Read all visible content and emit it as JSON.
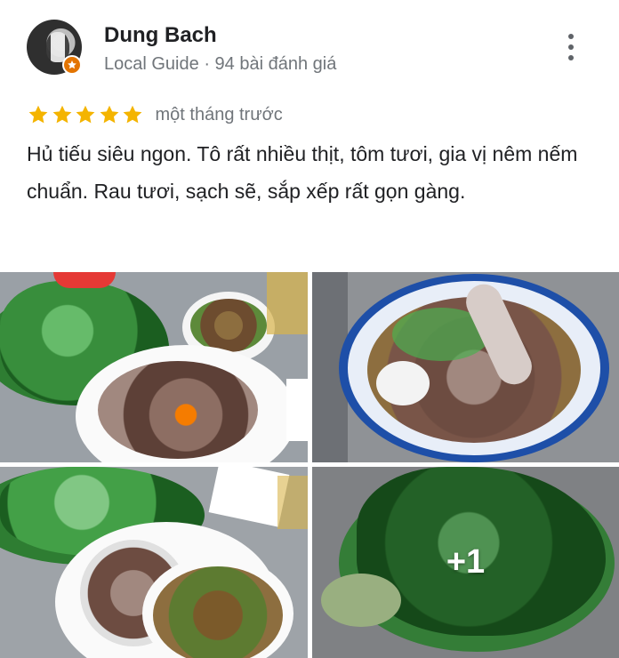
{
  "reviewer": {
    "name": "Dung Bach",
    "badge": "Local Guide",
    "separator": "·",
    "review_count": "94 bài đánh giá"
  },
  "review": {
    "stars": 5,
    "max_stars": 5,
    "time": "một tháng trước",
    "text": "Hủ tiếu siêu ngon. Tô rất nhiều thịt, tôm tươi, gia vị nêm nếm chuẩn. Rau tươi, sạch sẽ, sắp xếp rất gọn gàng."
  },
  "photos": {
    "more_count": "+1"
  },
  "colors": {
    "star": "#f4b400",
    "badge": "#e37400",
    "secondary_text": "#70757a"
  },
  "icons": {
    "more": "more-vert-icon",
    "badge": "local-guide-star-icon"
  }
}
